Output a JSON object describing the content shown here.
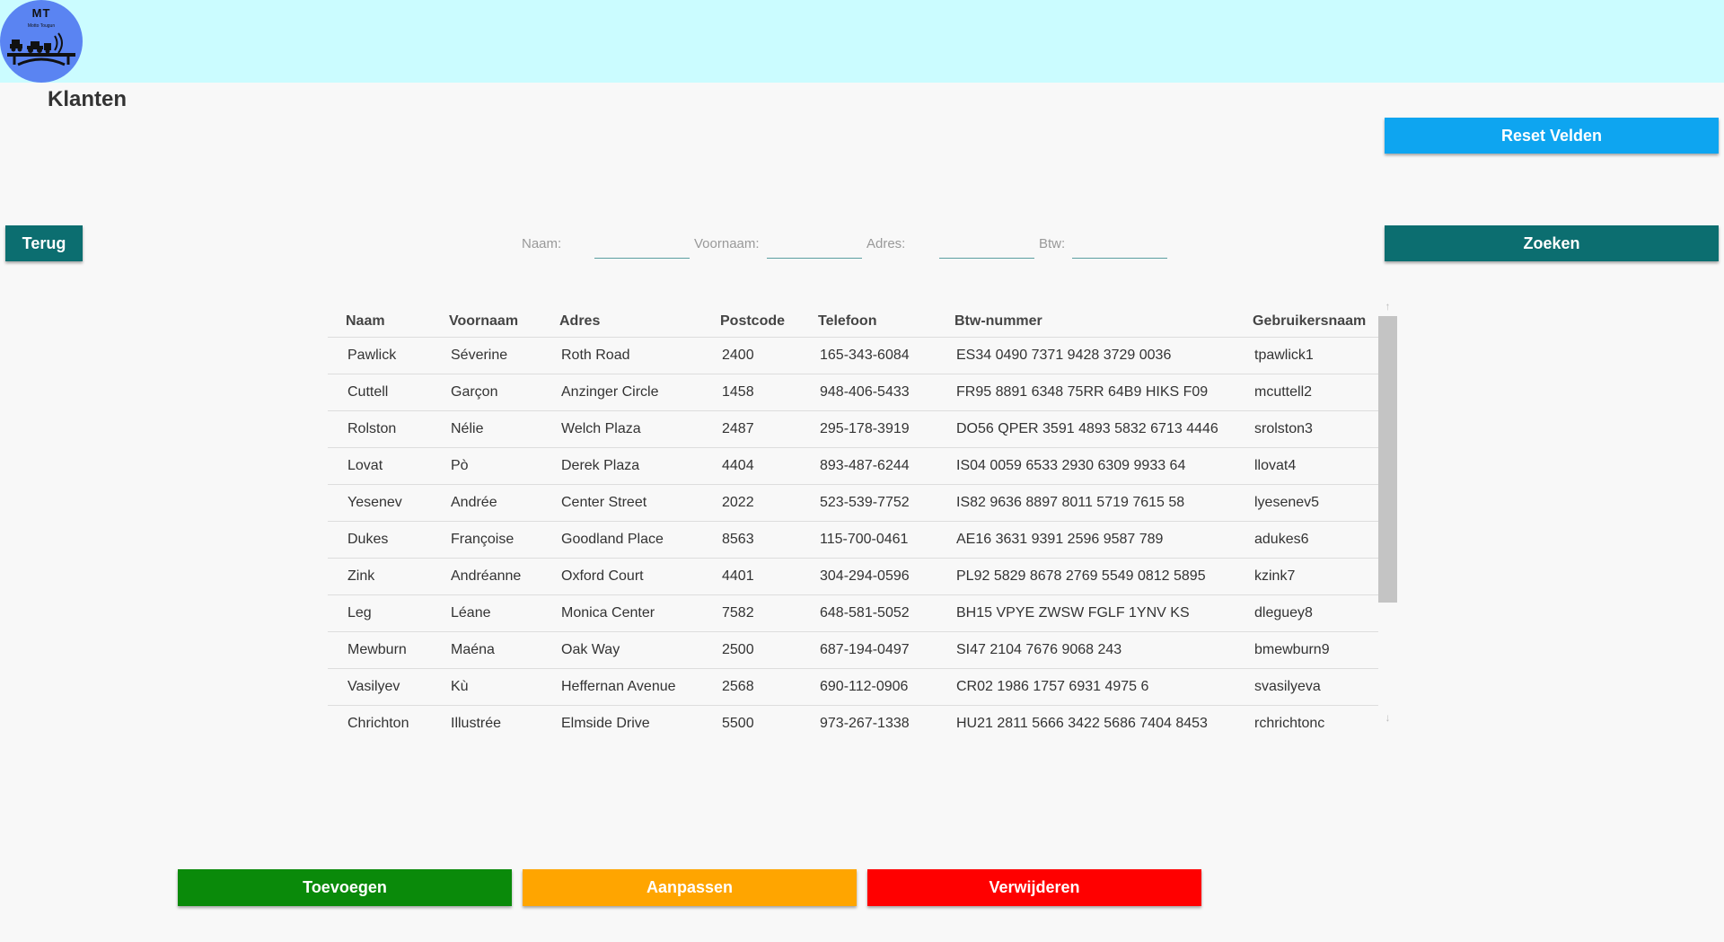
{
  "logo": {
    "title": "MT",
    "subtitle": "Motto Tougun"
  },
  "page": {
    "title": "Klanten"
  },
  "buttons": {
    "reset": "Reset Velden",
    "back": "Terug",
    "search": "Zoeken",
    "add": "Toevoegen",
    "edit": "Aanpassen",
    "delete": "Verwijderen"
  },
  "search": {
    "naam_label": "Naam:",
    "naam_value": "",
    "voornaam_label": "Voornaam:",
    "voornaam_value": "",
    "adres_label": "Adres:",
    "adres_value": "",
    "btw_label": "Btw:",
    "btw_value": ""
  },
  "table": {
    "columns": [
      "Naam",
      "Voornaam",
      "Adres",
      "Postcode",
      "Telefoon",
      "Btw-nummer",
      "Gebruikersnaam"
    ],
    "rows": [
      [
        "Pawlick",
        "Séverine",
        "Roth Road",
        "2400",
        "165-343-6084",
        "ES34 0490 7371 9428 3729 0036",
        "tpawlick1"
      ],
      [
        "Cuttell",
        "Garçon",
        "Anzinger Circle",
        "1458",
        "948-406-5433",
        "FR95 8891 6348 75RR 64B9 HIKS F09",
        "mcuttell2"
      ],
      [
        "Rolston",
        "Nélie",
        "Welch Plaza",
        "2487",
        "295-178-3919",
        "DO56 QPER 3591 4893 5832 6713 4446",
        "srolston3"
      ],
      [
        "Lovat",
        "Pò",
        "Derek Plaza",
        "4404",
        "893-487-6244",
        "IS04 0059 6533 2930 6309 9933 64",
        "llovat4"
      ],
      [
        "Yesenev",
        "Andrée",
        "Center Street",
        "2022",
        "523-539-7752",
        "IS82 9636 8897 8011 5719 7615 58",
        "lyesenev5"
      ],
      [
        "Dukes",
        "Françoise",
        "Goodland Place",
        "8563",
        "115-700-0461",
        "AE16 3631 9391 2596 9587 789",
        "adukes6"
      ],
      [
        "Zink",
        "Andréanne",
        "Oxford Court",
        "4401",
        "304-294-0596",
        "PL92 5829 8678 2769 5549 0812 5895",
        "kzink7"
      ],
      [
        "Leg",
        "Léane",
        "Monica Center",
        "7582",
        "648-581-5052",
        "BH15 VPYE ZWSW FGLF 1YNV KS",
        "dleguey8"
      ],
      [
        "Mewburn",
        "Maéna",
        "Oak Way",
        "2500",
        "687-194-0497",
        "SI47 2104 7676 9068 243",
        "bmewburn9"
      ],
      [
        "Vasilyev",
        "Kù",
        "Heffernan Avenue",
        "2568",
        "690-112-0906",
        "CR02 1986 1757 6931 4975 6",
        "svasilyeva"
      ],
      [
        "Chrichton",
        "Illustrée",
        "Elmside Drive",
        "5500",
        "973-267-1338",
        "HU21 2811 5666 3422 5686 7404 8453",
        "rchrichtonc"
      ]
    ]
  },
  "colors": {
    "header_bg": "#cbfcff",
    "logo_bg": "#5a84f2",
    "reset": "#0ea5f0",
    "primary_teal": "#0c6e70",
    "add": "#0a8a0a",
    "edit": "#ffa500",
    "delete": "#ff0000"
  },
  "icons": {
    "logo": "tractor-bridge-logo",
    "scroll_up": "arrow-up-icon",
    "scroll_down": "arrow-down-icon"
  }
}
